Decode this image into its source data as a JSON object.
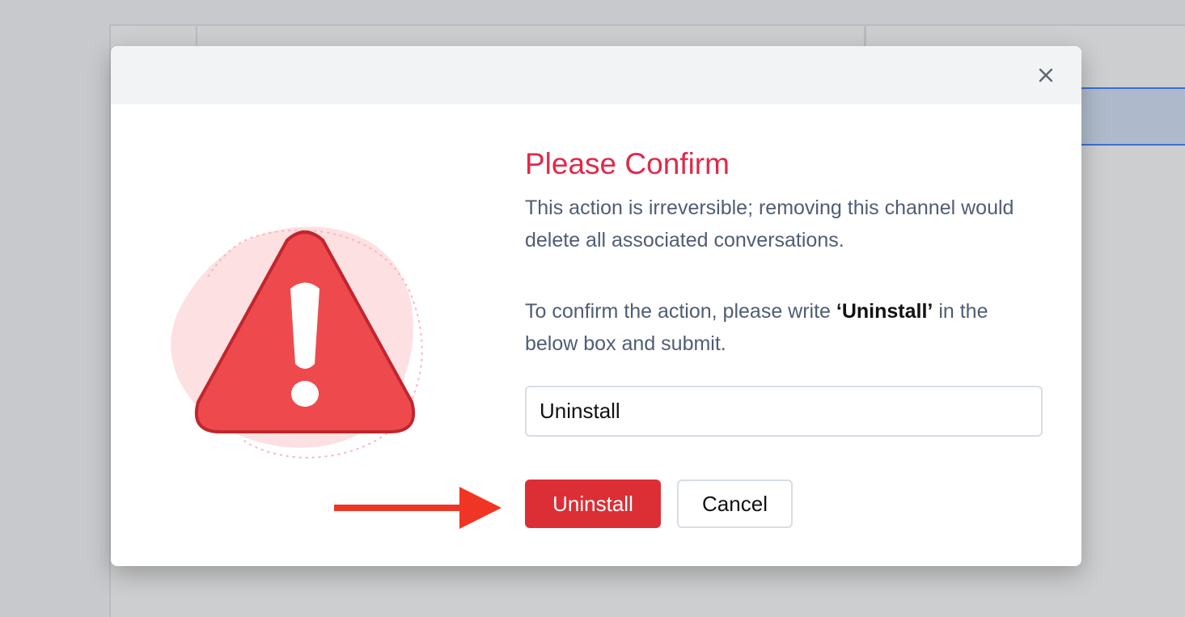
{
  "modal": {
    "close_icon": "close-icon",
    "title": "Please Confirm",
    "description": "This action is irreversible; removing this channel would delete all associated conversations.",
    "instruction_before": "To confirm the action, please write ",
    "instruction_keyword": "‘Uninstall’",
    "instruction_after": " in the below box and submit.",
    "input_value": "Uninstall",
    "primary_button": "Uninstall",
    "secondary_button": "Cancel",
    "illustration_icon": "warning-triangle-icon",
    "annotation_icon": "red-arrow-icon"
  },
  "colors": {
    "title": "#e0294a",
    "danger_button": "#dc2e35",
    "body_text": "#4f5d75",
    "header_bg": "#f2f3f5",
    "warning": "#ee4a4d",
    "annotation_arrow": "#f03525"
  }
}
